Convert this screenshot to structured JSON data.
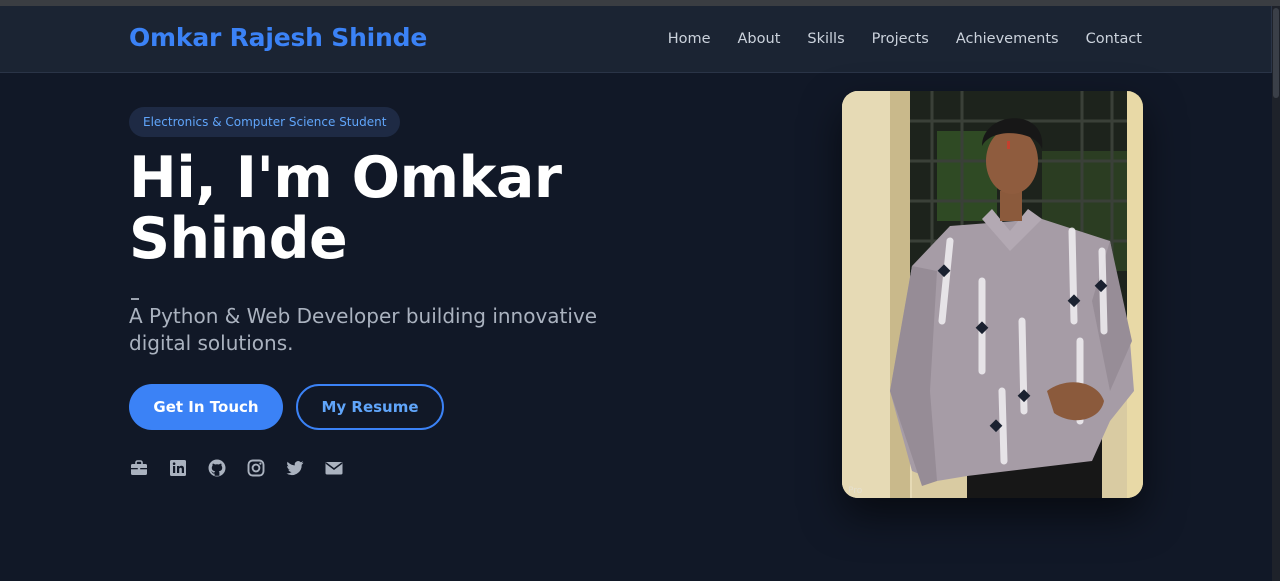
{
  "header": {
    "brand": "Omkar Rajesh Shinde",
    "nav": [
      "Home",
      "About",
      "Skills",
      "Projects",
      "Achievements",
      "Contact"
    ]
  },
  "hero": {
    "badge": "Electronics & Computer Science Student",
    "title": "Hi, I'm Omkar Shinde",
    "subtitle": "A Python & Web Developer building innovative digital solutions.",
    "primary_button": "Get In Touch",
    "secondary_button": "My Resume",
    "socials": [
      "briefcase-icon",
      "linkedin-icon",
      "github-icon",
      "instagram-icon",
      "twitter-icon",
      "envelope-icon"
    ]
  },
  "photo": {
    "watermark": "Pro"
  },
  "colors": {
    "background": "#111827",
    "navbar": "#1b2433",
    "accent": "#3b82f6",
    "badge_bg": "#1e2a44"
  }
}
